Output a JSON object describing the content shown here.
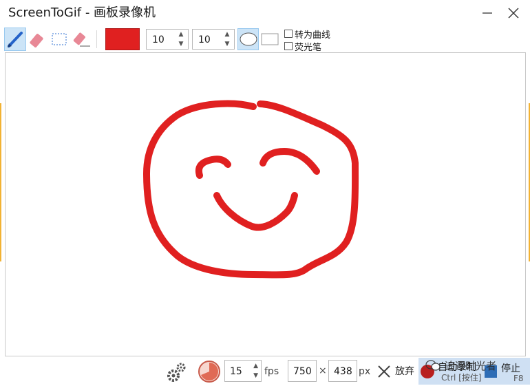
{
  "window": {
    "title": "ScreenToGif - 画板录像机"
  },
  "toolbar": {
    "tools": [
      "pen-icon",
      "eraser-icon",
      "selection-icon",
      "stroke-eraser-icon"
    ],
    "color": "#e02020",
    "width_value": "10",
    "height_value": "10",
    "shapes": [
      "ellipse-tip",
      "rectangle-tip"
    ],
    "fit_to_curve_label": "转为曲线",
    "highlighter_label": "荧光笔"
  },
  "canvas": {
    "stroke_color": "#e02020",
    "drawing": "smiley-face"
  },
  "statusbar": {
    "fps_value": "15",
    "fps_unit": "fps",
    "width_value": "750",
    "times_sign": "×",
    "height_value": "438",
    "px_unit": "px",
    "discard_label": "放弃",
    "record_label": "自动录制",
    "record_shortcut": "Ctrl [按住]",
    "stop_label": "停止",
    "stop_shortcut": "F8",
    "watermark_text": "追逐时光者"
  }
}
